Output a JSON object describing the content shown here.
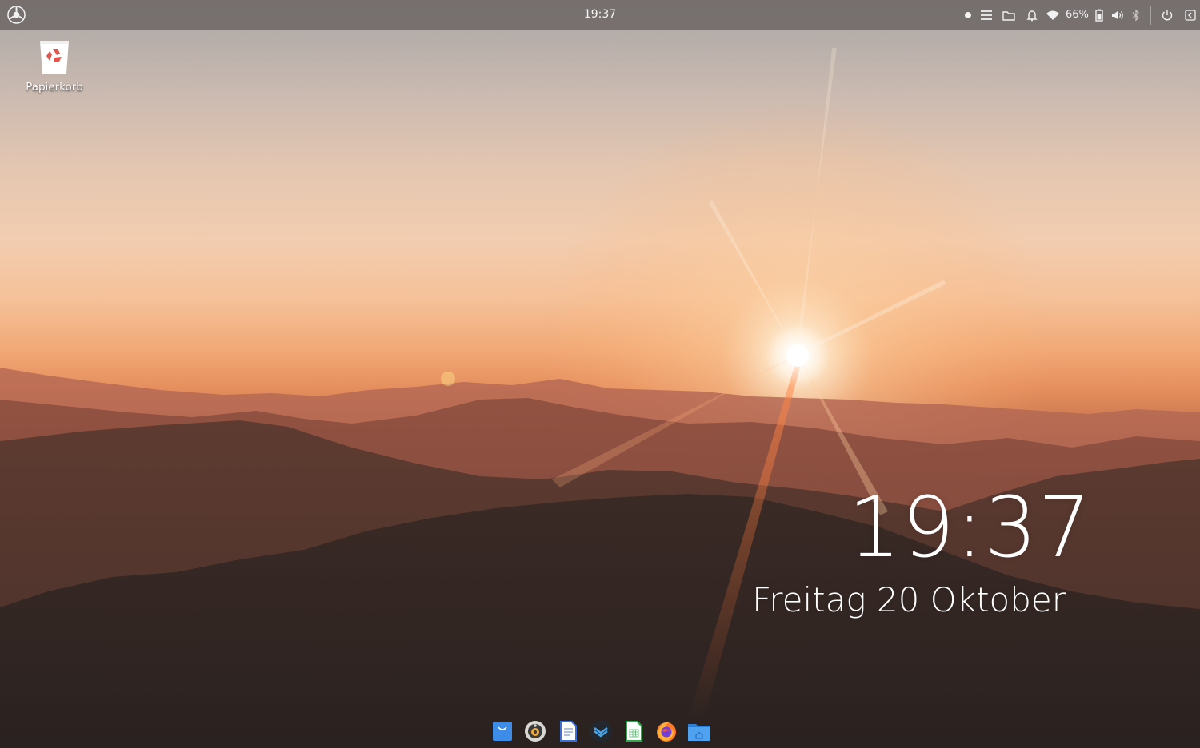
{
  "panel": {
    "clock": "19:37",
    "launcher_icon": "distro-logo-icon",
    "tray": {
      "battery_percent": "66%",
      "icons": [
        "record-dot-icon",
        "menu-icon",
        "folder-icon",
        "bell-icon",
        "wifi-icon",
        "battery-icon",
        "volume-icon",
        "bluetooth-icon",
        "power-icon",
        "sidebar-toggle-icon"
      ]
    }
  },
  "desktop": {
    "trash_label": "Papierkorb",
    "trash_icon": "trash-recycle-icon"
  },
  "clock_widget": {
    "time": "19:37",
    "date": "Freitag 20 Oktober"
  },
  "dock": {
    "items": [
      "store-bag-icon",
      "media-player-icon",
      "text-document-icon",
      "mail-icon",
      "spreadsheet-icon",
      "firefox-icon",
      "home-folder-icon"
    ]
  },
  "colors": {
    "panel_bg": "#6e6866",
    "accent_blue": "#3d8ce8",
    "trash_red": "#e0574f"
  }
}
